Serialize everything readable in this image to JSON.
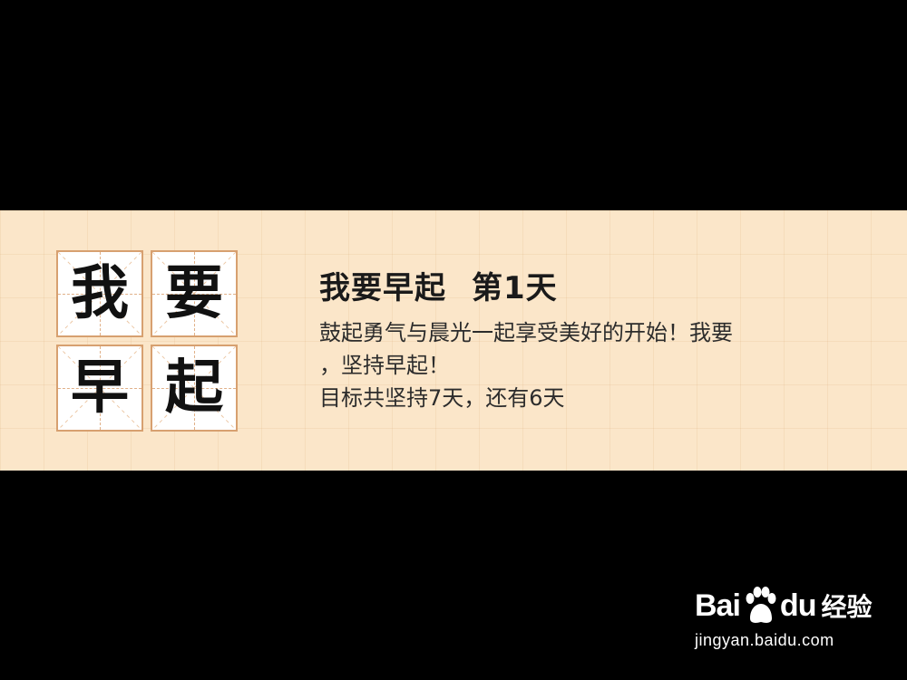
{
  "banner": {
    "grid": {
      "chars": [
        "我",
        "要",
        "早",
        "起"
      ]
    },
    "title": {
      "main": "我要早起",
      "day": "第1天"
    },
    "description_line1": "鼓起勇气与晨光一起享受美好的开始！我要",
    "description_line2": "，坚持早起！",
    "progress_text": "目标共坚持7天，还有6天",
    "colors": {
      "background": "#fbe6c9",
      "cell_border": "#d7a070",
      "text": "#1a1a1a"
    }
  },
  "watermark": {
    "brand_left": "Bai",
    "paw_icon": "baidu-paw-icon",
    "brand_mid": "du",
    "brand_cn": "经验",
    "url": "jingyan.baidu.com"
  }
}
